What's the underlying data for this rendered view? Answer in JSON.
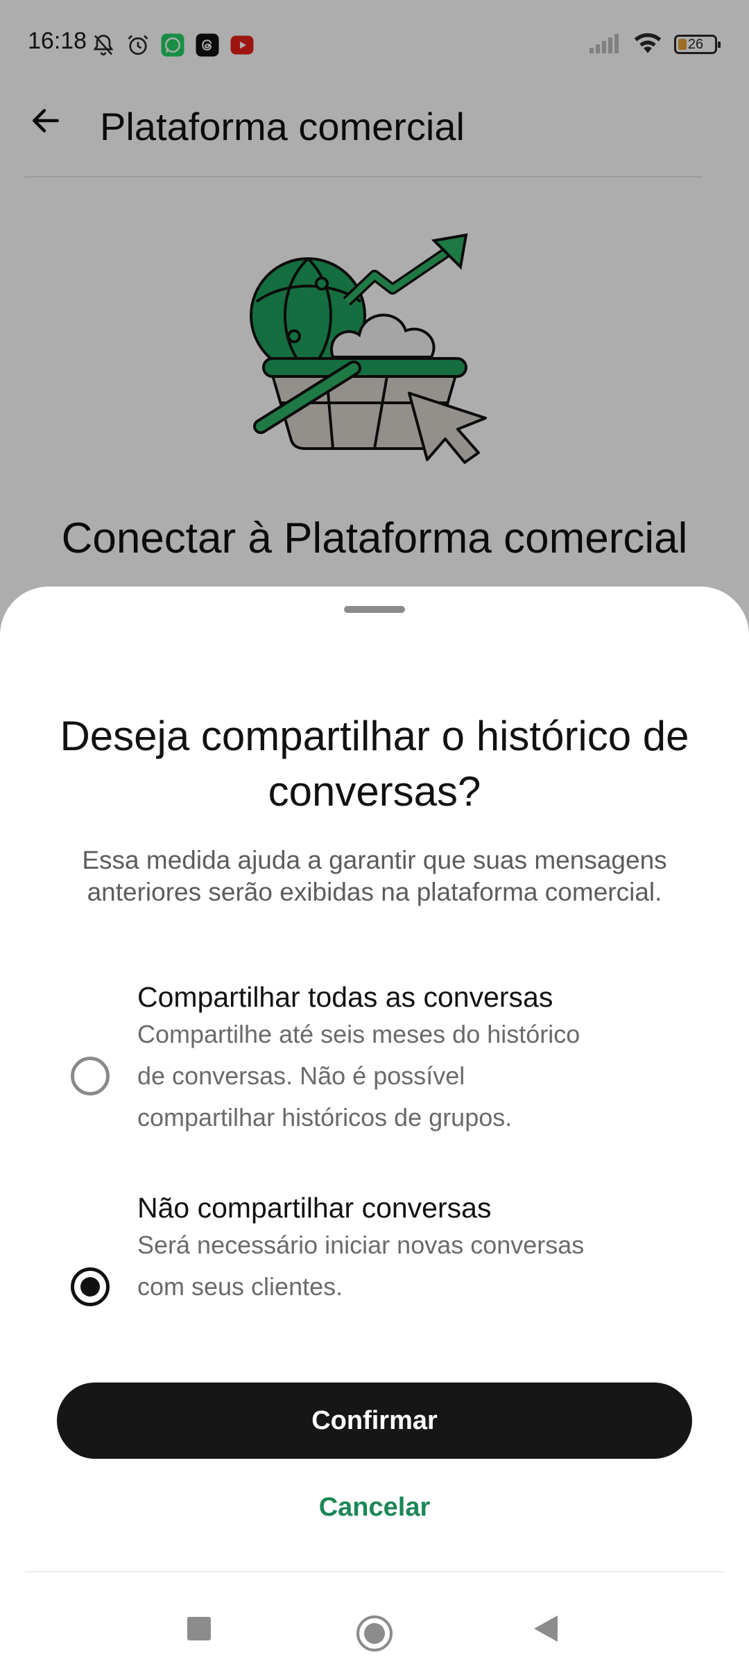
{
  "status_bar": {
    "time": "16:18",
    "battery_level": "26",
    "icons_left": [
      "notifications-off-icon",
      "alarm-icon",
      "whatsapp-business-icon",
      "threads-icon",
      "youtube-icon"
    ],
    "icons_right": [
      "signal-icon",
      "wifi-icon",
      "battery-icon"
    ]
  },
  "app_bar": {
    "title": "Plataforma comercial",
    "back_icon": "arrow-left-icon"
  },
  "background": {
    "heading_visible": "Conectar à Plataforma comercial"
  },
  "sheet": {
    "title": "Deseja compartilhar o histórico de conversas?",
    "description": "Essa medida ajuda a garantir que suas mensagens anteriores serão exibidas na plataforma comercial.",
    "options": [
      {
        "title": "Compartilhar todas as conversas",
        "description": "Compartilhe até seis meses do histórico de conversas. Não é possível compartilhar históricos de grupos.",
        "selected": false
      },
      {
        "title": "Não compartilhar conversas",
        "description": "Será necessário iniciar novas conversas com seus clientes.",
        "selected": true
      }
    ],
    "confirm_label": "Confirmar",
    "cancel_label": "Cancelar"
  },
  "colors": {
    "accent_green": "#1b8755",
    "button_dark": "#161616",
    "illustration_green": "#1fa25e"
  },
  "nav_bar": {
    "icons": [
      "recents-square-icon",
      "home-circle-icon",
      "back-triangle-icon"
    ]
  }
}
